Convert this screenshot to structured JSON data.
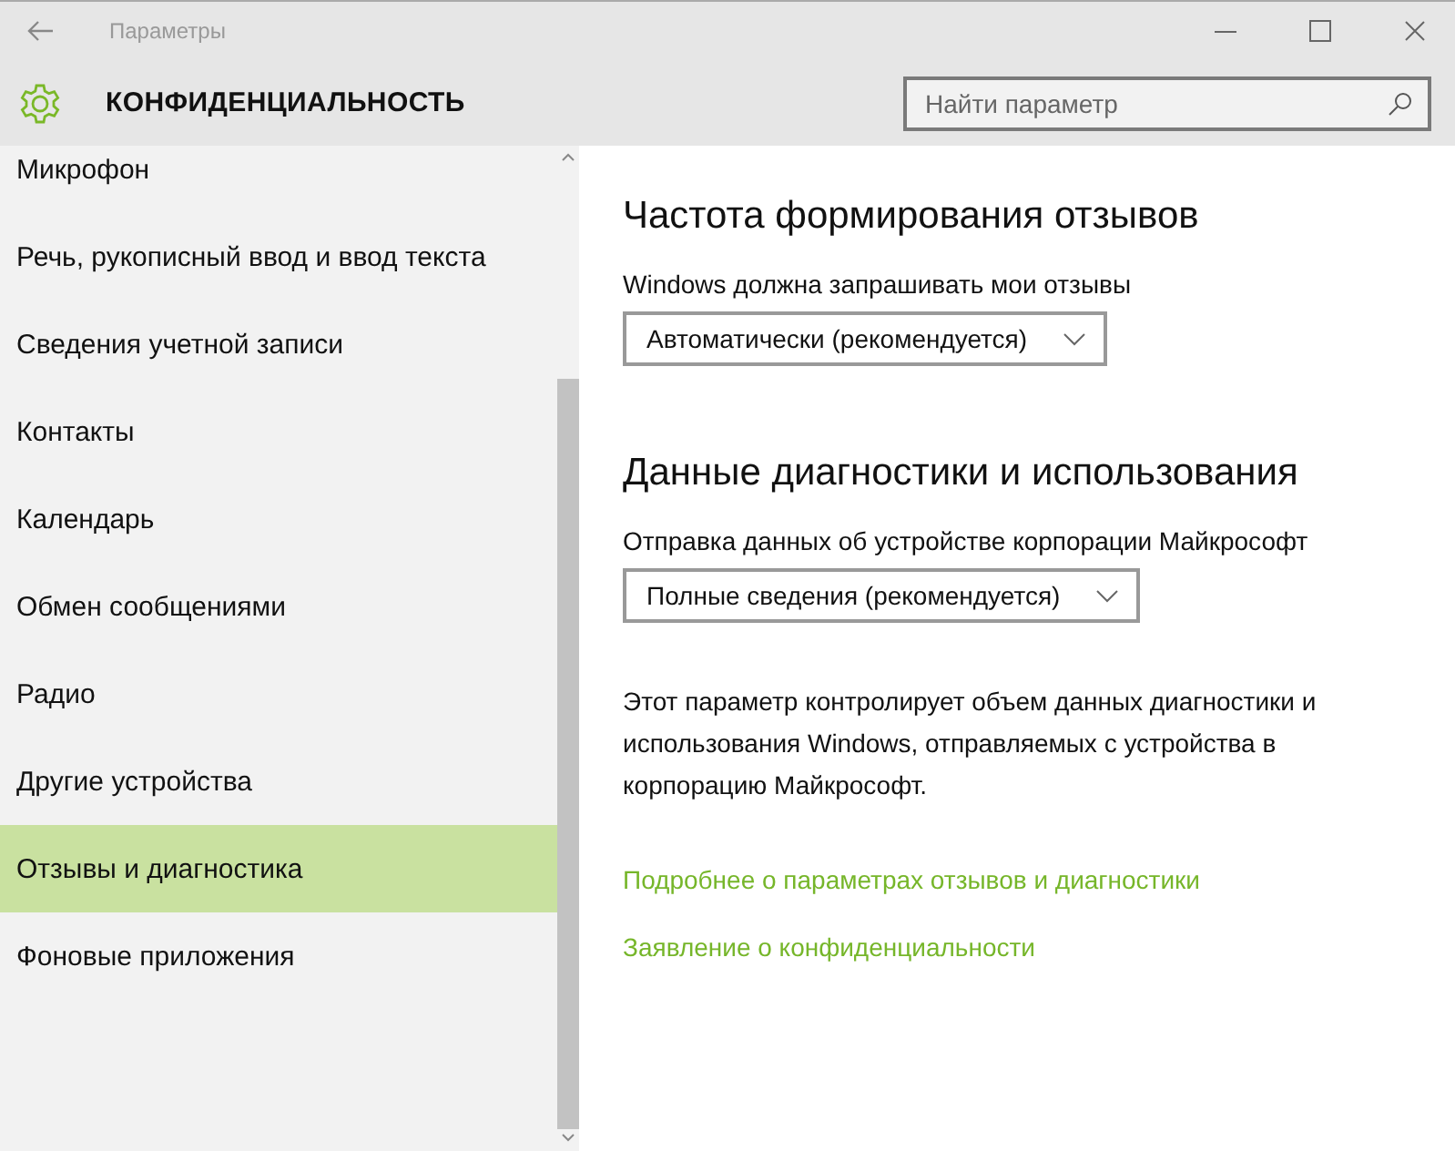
{
  "window": {
    "title": "Параметры"
  },
  "header": {
    "title": "КОНФИДЕНЦИАЛЬНОСТЬ"
  },
  "search": {
    "placeholder": "Найти параметр"
  },
  "sidebar": {
    "items": [
      {
        "label": "Микрофон",
        "selected": false
      },
      {
        "label": "Речь, рукописный ввод и ввод текста",
        "selected": false
      },
      {
        "label": "Сведения учетной записи",
        "selected": false
      },
      {
        "label": "Контакты",
        "selected": false
      },
      {
        "label": "Календарь",
        "selected": false
      },
      {
        "label": "Обмен сообщениями",
        "selected": false
      },
      {
        "label": "Радио",
        "selected": false
      },
      {
        "label": "Другие устройства",
        "selected": false
      },
      {
        "label": "Отзывы и диагностика",
        "selected": true
      },
      {
        "label": "Фоновые приложения",
        "selected": false
      }
    ]
  },
  "sections": [
    {
      "heading": "Частота формирования отзывов",
      "label": "Windows должна запрашивать мои отзывы",
      "dropdown": {
        "value": "Автоматически (рекомендуется)"
      }
    },
    {
      "heading": "Данные диагностики и использования",
      "label": "Отправка данных об устройстве корпорации Майкрософт",
      "dropdown": {
        "value": "Полные сведения (рекомендуется)"
      },
      "description": "Этот параметр контролирует объем данных диагностики и использования Windows, отправляемых с устройства в корпорацию Майкрософт."
    }
  ],
  "links": [
    "Подробнее о параметрах отзывов и диагностики",
    "Заявление о конфиденциальности"
  ]
}
